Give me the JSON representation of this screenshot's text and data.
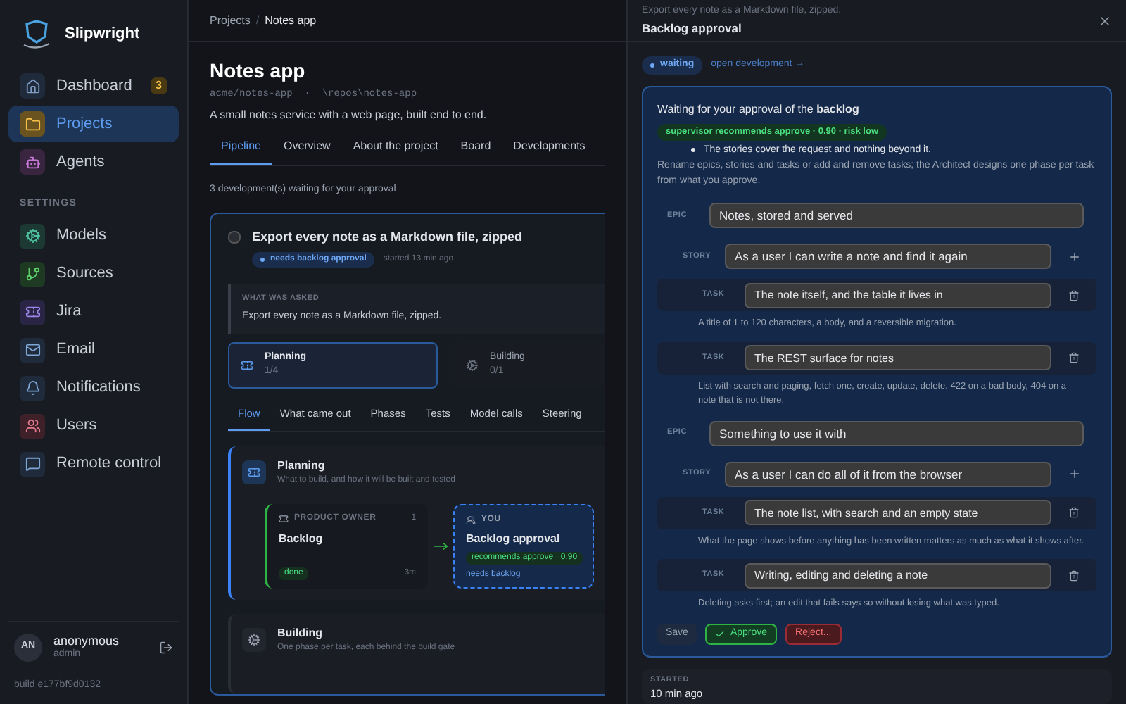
{
  "app": {
    "name": "Slipwright"
  },
  "sidebar": {
    "items": [
      {
        "label": "Dashboard",
        "badge": "3",
        "selected": false
      },
      {
        "label": "Projects",
        "selected": true
      },
      {
        "label": "Agents",
        "selected": false
      }
    ],
    "section": "SETTINGS",
    "settings_items": [
      {
        "label": "Models",
        "selected": false
      },
      {
        "label": "Sources",
        "selected": false
      },
      {
        "label": "Jira",
        "selected": false
      },
      {
        "label": "Email",
        "selected": false
      },
      {
        "label": "Notifications",
        "selected": false
      },
      {
        "label": "Users",
        "selected": false
      },
      {
        "label": "Remote control",
        "selected": false
      }
    ],
    "user": {
      "initials": "AN",
      "name": "anonymous",
      "role": "admin"
    },
    "build": "build e177bf9d0132"
  },
  "breadcrumb": {
    "items": [
      "Projects",
      "Notes app"
    ],
    "separator": "/"
  },
  "project": {
    "title": "Notes app",
    "repo": "acme/notes-app  ·  \\repos\\notes-app",
    "description": "A small notes service with a web page, built end to end."
  },
  "tabs": [
    {
      "label": "Pipeline",
      "selected": true
    },
    {
      "label": "Overview",
      "selected": false
    },
    {
      "label": "About the project",
      "selected": false
    },
    {
      "label": "Board",
      "selected": false
    },
    {
      "label": "Developments",
      "selected": false
    }
  ],
  "waiting_text": "3 development(s) waiting for your approval",
  "development": {
    "title": "Export every note as a Markdown file, zipped",
    "checked": false,
    "status": "needs backlog approval",
    "started": "started 13 min ago",
    "asked_label": "WHAT WAS ASKED",
    "asked": "Export every note as a Markdown file, zipped.",
    "stages": [
      {
        "name": "Planning",
        "progress": "1/4",
        "selected": true
      },
      {
        "name": "Building",
        "progress": "0/1",
        "selected": false
      }
    ],
    "subtabs": [
      {
        "label": "Flow",
        "selected": true
      },
      {
        "label": "What came out",
        "selected": false
      },
      {
        "label": "Phases",
        "selected": false
      },
      {
        "label": "Tests",
        "selected": false
      },
      {
        "label": "Model calls",
        "selected": false
      },
      {
        "label": "Steering",
        "selected": false
      }
    ],
    "sections": [
      {
        "title": "Planning",
        "subtitle": "What to build, and how it will be built and tested",
        "active": true,
        "nodes": [
          {
            "kind": "agent",
            "role": "PRODUCT OWNER",
            "count": "1",
            "title": "Backlog",
            "status": "done",
            "time": "3m"
          },
          {
            "kind": "human",
            "role": "YOU",
            "title": "Backlog approval",
            "badge": "recommends approve · 0.90",
            "status": "needs backlog"
          }
        ]
      },
      {
        "title": "Building",
        "subtitle": "One phase per task, each behind the build gate",
        "active": false
      }
    ]
  },
  "drawer": {
    "subtitle": "Export every note as a Markdown file, zipped.",
    "title": "Backlog approval",
    "status": "waiting",
    "link": "open development →",
    "heading": "Waiting for your approval of the **backlog**",
    "recommendation": "supervisor recommends approve · 0.90 · risk low",
    "reasons": [
      "The stories cover the request and nothing beyond it."
    ],
    "instructions": "Rename epics, stories and tasks or add and remove tasks; the Architect designs one phase per task from what you approve.",
    "epics": [
      {
        "label": "EPIC",
        "value": "Notes, stored and served",
        "stories": [
          {
            "label": "STORY",
            "value": "As a user I can write a note and find it again",
            "tasks": [
              {
                "label": "TASK",
                "value": "The note itself, and the table it lives in",
                "note": "A title of 1 to 120 characters, a body, and a reversible migration."
              },
              {
                "label": "TASK",
                "value": "The REST surface for notes",
                "note": "List with search and paging, fetch one, create, update, delete. 422 on a bad body, 404 on a note that is not there."
              }
            ]
          }
        ]
      },
      {
        "label": "EPIC",
        "value": "Something to use it with",
        "stories": [
          {
            "label": "STORY",
            "value": "As a user I can do all of it from the browser",
            "tasks": [
              {
                "label": "TASK",
                "value": "The note list, with search and an empty state",
                "note": "What the page shows before anything has been written matters as much as what it shows after."
              },
              {
                "label": "TASK",
                "value": "Writing, editing and deleting a note",
                "note": "Deleting asks first; an edit that fails says so without losing what was typed."
              }
            ]
          }
        ]
      }
    ],
    "actions": [
      {
        "kind": "save",
        "label": "Save"
      },
      {
        "kind": "approve",
        "label": "Approve"
      },
      {
        "kind": "reject",
        "label": "Reject..."
      }
    ],
    "started_label": "STARTED",
    "started": "10 min ago"
  }
}
